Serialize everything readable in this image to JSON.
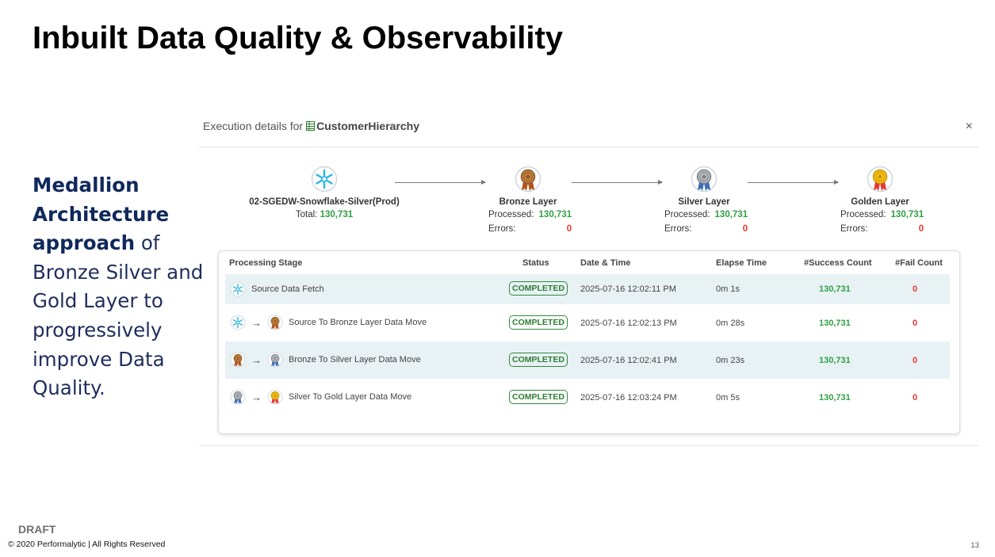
{
  "slide": {
    "title": "Inbuilt Data Quality & Observability",
    "description": {
      "bold": "Medallion Architecture approach",
      "rest": " of Bronze Silver and Gold Layer to progressively improve Data Quality."
    },
    "draft_label": "DRAFT",
    "copyright": "© 2020  Performalytic |   All Rights Reserved",
    "page_number": "13"
  },
  "panel": {
    "prefix": "Execution details for",
    "name": "CustomerHierarchy",
    "close": "×"
  },
  "pipeline": [
    {
      "name": "02-SGEDW-Snowflake-Silver(Prod)",
      "icon": "snowflake-icon",
      "total_label": "Total:",
      "total": "130,731"
    },
    {
      "name": "Bronze Layer",
      "icon": "bronze-medal-icon",
      "processed_label": "Processed:",
      "processed": "130,731",
      "errors_label": "Errors:",
      "errors": "0"
    },
    {
      "name": "Silver Layer",
      "icon": "silver-medal-icon",
      "processed_label": "Processed:",
      "processed": "130,731",
      "errors_label": "Errors:",
      "errors": "0"
    },
    {
      "name": "Golden Layer",
      "icon": "gold-medal-icon",
      "processed_label": "Processed:",
      "processed": "130,731",
      "errors_label": "Errors:",
      "errors": "0"
    }
  ],
  "table": {
    "headers": [
      "Processing Stage",
      "Status",
      "Date & Time",
      "Elapse Time",
      "#Success Count",
      "#Fail Count"
    ],
    "rows": [
      {
        "icons": [
          "snowflake-icon"
        ],
        "stage": "Source Data Fetch",
        "status": "COMPLETED",
        "datetime": "2025-07-16 12:02:11 PM",
        "elapsed": "0m 1s",
        "success": "130,731",
        "fail": "0"
      },
      {
        "icons": [
          "snowflake-icon",
          "bronze-medal-icon"
        ],
        "arrow": "→",
        "stage": "Source To Bronze Layer Data Move",
        "status": "COMPLETED",
        "datetime": "2025-07-16 12:02:13 PM",
        "elapsed": "0m 28s",
        "success": "130,731",
        "fail": "0"
      },
      {
        "icons": [
          "bronze-medal-icon",
          "silver-medal-icon"
        ],
        "arrow": "→",
        "stage": "Bronze To Silver Layer Data Move",
        "status": "COMPLETED",
        "datetime": "2025-07-16 12:02:41 PM",
        "elapsed": "0m 23s",
        "success": "130,731",
        "fail": "0"
      },
      {
        "icons": [
          "silver-medal-icon",
          "gold-medal-icon"
        ],
        "arrow": "→",
        "stage": "Silver To Gold Layer Data Move",
        "status": "COMPLETED",
        "datetime": "2025-07-16 12:03:24 PM",
        "elapsed": "0m 5s",
        "success": "130,731",
        "fail": "0"
      }
    ]
  },
  "colors": {
    "success": "#2ea043",
    "fail": "#e53935",
    "badge": "#2e8b3d",
    "row_alt": "#e8f1f4",
    "heading_navy": "#10285c"
  }
}
